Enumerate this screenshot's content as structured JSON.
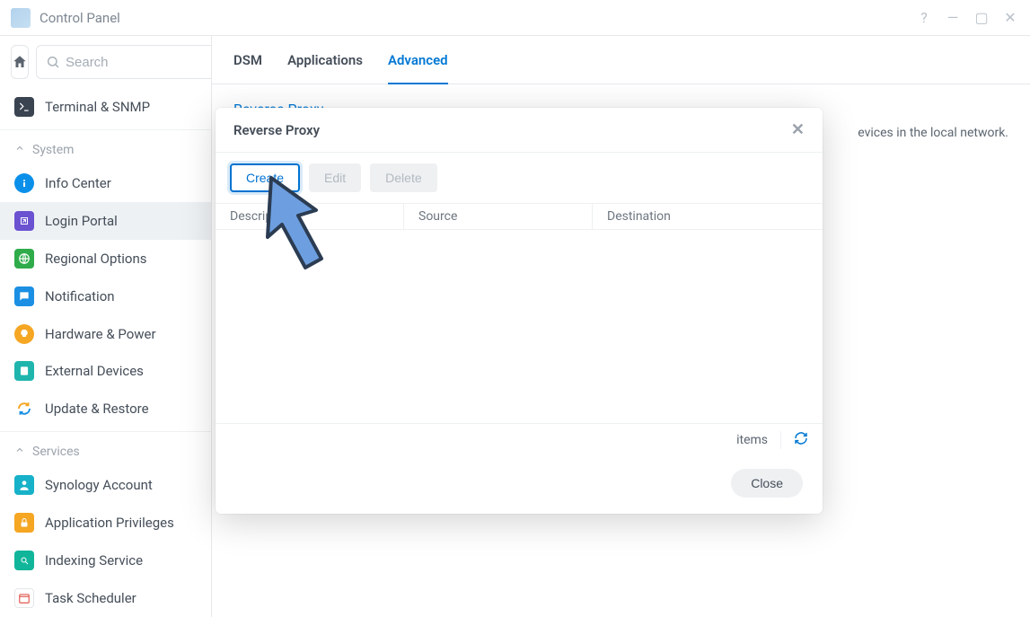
{
  "window": {
    "title": "Control Panel"
  },
  "sidebar": {
    "search_placeholder": "Search",
    "top_item": {
      "label": "Terminal & SNMP"
    },
    "groups": [
      {
        "label": "System",
        "items": [
          {
            "id": "info-center",
            "label": "Info Center"
          },
          {
            "id": "login-portal",
            "label": "Login Portal",
            "selected": true
          },
          {
            "id": "regional-options",
            "label": "Regional Options"
          },
          {
            "id": "notification",
            "label": "Notification"
          },
          {
            "id": "hardware-power",
            "label": "Hardware & Power"
          },
          {
            "id": "external-devices",
            "label": "External Devices"
          },
          {
            "id": "update-restore",
            "label": "Update & Restore"
          }
        ]
      },
      {
        "label": "Services",
        "items": [
          {
            "id": "synology-account",
            "label": "Synology Account"
          },
          {
            "id": "application-privileges",
            "label": "Application Privileges"
          },
          {
            "id": "indexing-service",
            "label": "Indexing Service"
          },
          {
            "id": "task-scheduler",
            "label": "Task Scheduler"
          }
        ]
      }
    ]
  },
  "main": {
    "tabs": [
      {
        "id": "dsm",
        "label": "DSM"
      },
      {
        "id": "applications",
        "label": "Applications"
      },
      {
        "id": "advanced",
        "label": "Advanced",
        "active": true
      }
    ],
    "section_title": "Reverse Proxy",
    "section_desc_tail": "evices in the local network."
  },
  "modal": {
    "title": "Reverse Proxy",
    "buttons": {
      "create": "Create",
      "edit": "Edit",
      "delete": "Delete",
      "close": "Close"
    },
    "columns": {
      "description": "Description",
      "source": "Source",
      "destination": "Destination"
    },
    "status": "items"
  }
}
